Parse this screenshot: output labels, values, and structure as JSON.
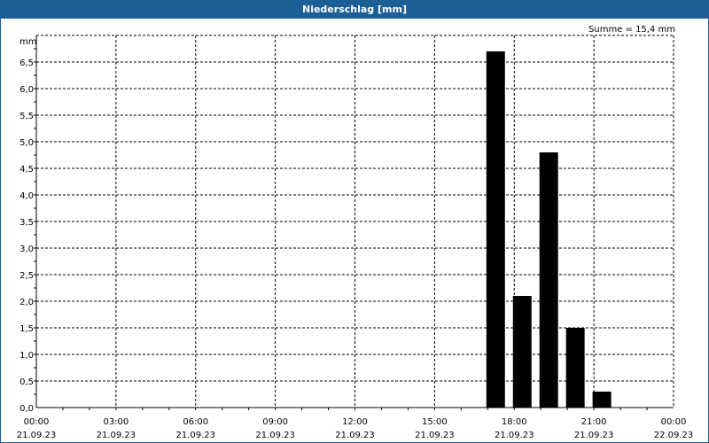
{
  "chart_data": {
    "type": "bar",
    "title": "Niederschlag [mm]",
    "ylabel": "mm",
    "annotation": "Summe = 15,4 mm",
    "ylim": [
      0,
      7
    ],
    "yticks": [
      "0,0",
      "0,5",
      "1,0",
      "1,5",
      "2,0",
      "2,5",
      "3,0",
      "3,5",
      "4,0",
      "4,5",
      "5,0",
      "5,5",
      "6,0",
      "6,5"
    ],
    "xticks": [
      {
        "time": "00:00",
        "date": "21.09.23"
      },
      {
        "time": "03:00",
        "date": "21.09.23"
      },
      {
        "time": "06:00",
        "date": "21.09.23"
      },
      {
        "time": "09:00",
        "date": "21.09.23"
      },
      {
        "time": "12:00",
        "date": "21.09.23"
      },
      {
        "time": "15:00",
        "date": "21.09.23"
      },
      {
        "time": "18:00",
        "date": "21.09.23"
      },
      {
        "time": "21:00",
        "date": "21.09.23"
      },
      {
        "time": "00:00",
        "date": "22.09.23"
      }
    ],
    "x_unit": "hours since 21.09.23 00:00",
    "bars": [
      {
        "x": 17,
        "value": 6.7
      },
      {
        "x": 18,
        "value": 2.1
      },
      {
        "x": 19,
        "value": 4.8
      },
      {
        "x": 20,
        "value": 1.5
      },
      {
        "x": 21,
        "value": 0.3
      }
    ],
    "grid": true,
    "bar_color": "#000000"
  }
}
